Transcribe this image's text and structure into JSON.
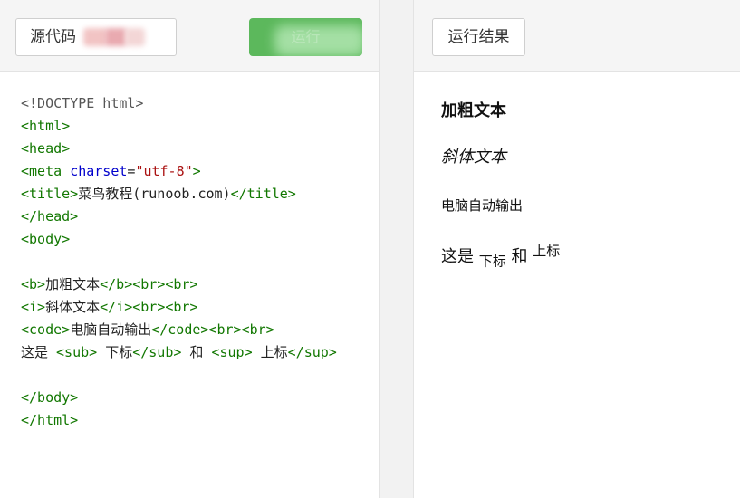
{
  "left": {
    "source_button_label": "源代码",
    "run_button_label": "运行",
    "code_lines": [
      [
        {
          "t": "doc",
          "v": "<!DOCTYPE html>"
        }
      ],
      [
        {
          "t": "tag",
          "v": "<html>"
        }
      ],
      [
        {
          "t": "tag",
          "v": "<head>"
        }
      ],
      [
        {
          "t": "tag",
          "v": "<meta "
        },
        {
          "t": "attr",
          "v": "charset"
        },
        {
          "t": "text",
          "v": "="
        },
        {
          "t": "str",
          "v": "\"utf-8\""
        },
        {
          "t": "tag",
          "v": ">"
        }
      ],
      [
        {
          "t": "tag",
          "v": "<title>"
        },
        {
          "t": "text",
          "v": "菜鸟教程(runoob.com)"
        },
        {
          "t": "tag",
          "v": "</title>"
        }
      ],
      [
        {
          "t": "tag",
          "v": "</head>"
        }
      ],
      [
        {
          "t": "tag",
          "v": "<body>"
        }
      ],
      [],
      [
        {
          "t": "tag",
          "v": "<b>"
        },
        {
          "t": "text",
          "v": "加粗文本"
        },
        {
          "t": "tag",
          "v": "</b><br><br>"
        }
      ],
      [
        {
          "t": "tag",
          "v": "<i>"
        },
        {
          "t": "text",
          "v": "斜体文本"
        },
        {
          "t": "tag",
          "v": "</i><br><br>"
        }
      ],
      [
        {
          "t": "tag",
          "v": "<code>"
        },
        {
          "t": "text",
          "v": "电脑自动输出"
        },
        {
          "t": "tag",
          "v": "</code><br><br>"
        }
      ],
      [
        {
          "t": "text",
          "v": "这是 "
        },
        {
          "t": "tag",
          "v": "<sub>"
        },
        {
          "t": "text",
          "v": " 下标"
        },
        {
          "t": "tag",
          "v": "</sub>"
        },
        {
          "t": "text",
          "v": " 和 "
        },
        {
          "t": "tag",
          "v": "<sup>"
        },
        {
          "t": "text",
          "v": " 上标"
        },
        {
          "t": "tag",
          "v": "</sup>"
        }
      ],
      [],
      [
        {
          "t": "tag",
          "v": "</body>"
        }
      ],
      [
        {
          "t": "tag",
          "v": "</html>"
        }
      ]
    ]
  },
  "right": {
    "result_button_label": "运行结果",
    "bold_text": "加粗文本",
    "italic_text": "斜体文本",
    "code_text": "电脑自动输出",
    "line4_prefix": "这是",
    "sub_text": "下标",
    "line4_and": "和",
    "sup_text": "上标"
  },
  "colors": {
    "run_button": "#5cb85c",
    "tag": "#117700",
    "attr": "#0000cc",
    "string": "#aa1111",
    "doctype": "#555555"
  }
}
